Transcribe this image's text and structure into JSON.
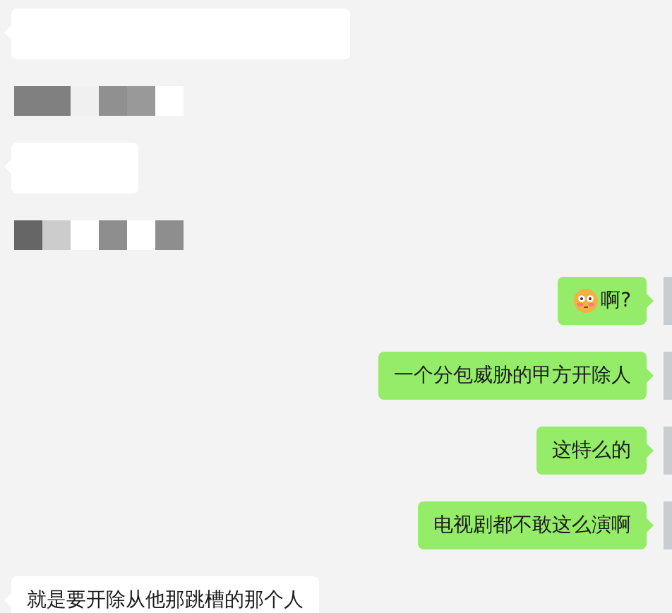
{
  "messages": [
    {
      "outgoing": false,
      "kind": "blank"
    },
    {
      "outgoing": false,
      "kind": "mosaic"
    },
    {
      "outgoing": false,
      "kind": "blank"
    },
    {
      "outgoing": false,
      "kind": "mosaic"
    },
    {
      "outgoing": true,
      "kind": "emoji_text",
      "text": "啊?"
    },
    {
      "outgoing": true,
      "kind": "text",
      "text": "一个分包威胁的甲方开除人"
    },
    {
      "outgoing": true,
      "kind": "text",
      "text": "这特么的"
    },
    {
      "outgoing": true,
      "kind": "text",
      "text": "电视剧都不敢这么演啊"
    },
    {
      "outgoing": false,
      "kind": "text",
      "text": "就是要开除从他那跳槽的那个人"
    }
  ]
}
